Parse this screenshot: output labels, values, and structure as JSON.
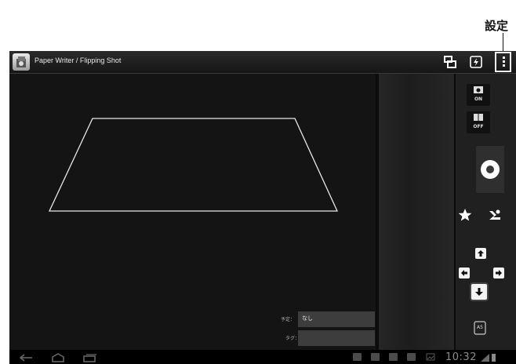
{
  "callout": {
    "label": "設定"
  },
  "app": {
    "title": "Paper Writer / Flipping Shot"
  },
  "actionbar": {
    "icons": [
      "window-mode-icon",
      "flash-icon",
      "overflow-menu-icon"
    ]
  },
  "side_panel": {
    "auto_toggle_state": "ON",
    "page_toggle_state": "OFF",
    "page_size_badge": "A5"
  },
  "fields": [
    {
      "label": "予定：",
      "value": "なし"
    },
    {
      "label": "タグ：",
      "value": ""
    }
  ],
  "status": {
    "clock": "10:32"
  },
  "colors": {
    "background": "#000000",
    "panel": "#202020",
    "accent": "#ffffff"
  }
}
